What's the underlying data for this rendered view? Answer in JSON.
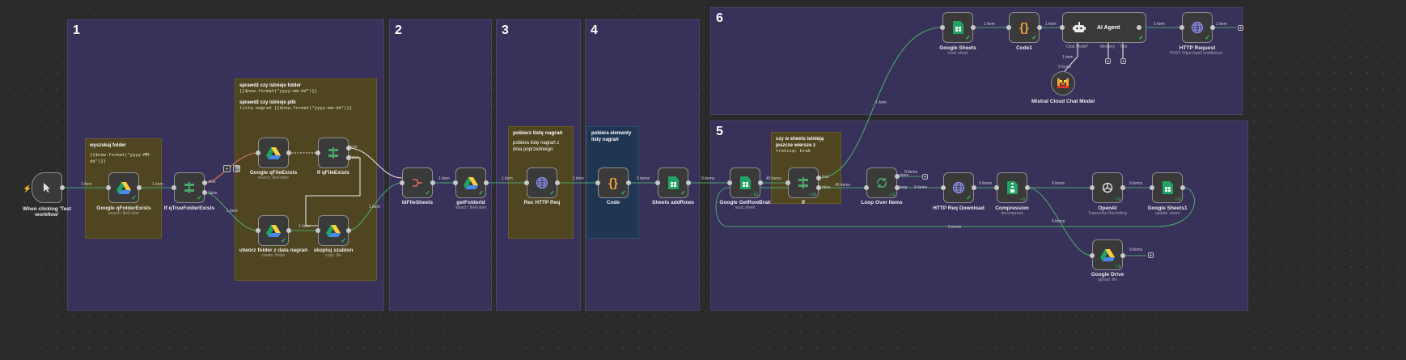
{
  "areas": {
    "a1": "1",
    "a2": "2",
    "a3": "3",
    "a4": "4",
    "a5": "5",
    "a6": "6"
  },
  "stickies": {
    "s1": {
      "title": "wyszukaj folder",
      "code": "{{$now.format(\"yyyy-MM-dd\")}}"
    },
    "s2": {
      "title1": "sprawdź czy istnieje folder",
      "code1": "{{$now.format(\"yyyy-mm-dd\")}}",
      "title2": "sprawdź czy istnieje plik",
      "code2": "lista nagrań {{$now.format(\"yyyy-mm-dd\")}}"
    },
    "s3": {
      "title": "pobierz listę nagrań",
      "body": "pobiera listę nagrań z dnia poprzedniego"
    },
    "s4": {
      "title": "pobiera elementy listy nagrań"
    },
    "s5": {
      "title": "czy w sheets istnieją jeszcze wiersze z",
      "code": "treścią: brak"
    }
  },
  "nodes": {
    "trigger": {
      "label": "When clicking 'Test workflow'",
      "icon": "cursor-icon"
    },
    "gfolder": {
      "label": "Google qFolderExists",
      "sub": "search: fileFolder",
      "icon": "google-drive-icon"
    },
    "if1": {
      "label": "If qTrueFolderExists",
      "icon": "if-icon"
    },
    "gfile": {
      "label": "Google qFileExists",
      "sub": "search: fileFolder",
      "icon": "google-drive-icon"
    },
    "if2": {
      "label": "If qFileExists",
      "icon": "if-icon"
    },
    "create": {
      "label": "utwórz folder z data nagrań",
      "sub": "create: folder",
      "icon": "google-drive-icon"
    },
    "copy": {
      "label": "skopiuj szablon",
      "sub": "copy: file",
      "icon": "google-drive-icon"
    },
    "idfile": {
      "label": "IdFileSheets",
      "icon": "merge-icon"
    },
    "getfolder": {
      "label": "getFolderId",
      "sub": "search: fileFolder",
      "icon": "google-drive-icon"
    },
    "rec": {
      "label": "Rec HTTP Req",
      "icon": "globe-icon"
    },
    "code": {
      "label": "Code",
      "icon": "code-icon"
    },
    "addrows": {
      "label": "Sheets addRows",
      "icon": "google-sheets-icon"
    },
    "getrow": {
      "label": "Google GetRowBrak",
      "sub": "read: sheet",
      "icon": "google-sheets-icon",
      "count": "10"
    },
    "if3": {
      "label": "If",
      "icon": "if-icon",
      "count": "10"
    },
    "loop": {
      "label": "Loop Over Items",
      "icon": "loop-icon",
      "count": "2"
    },
    "httpdl": {
      "label": "HTTP Req Download",
      "icon": "globe-icon"
    },
    "comp": {
      "label": "Compression",
      "sub": "decompress",
      "icon": "compression-icon",
      "count": "9"
    },
    "openai": {
      "label": "OpenAI",
      "sub": "Transcribe Recording",
      "icon": "openai-icon",
      "count": "9"
    },
    "sheets1": {
      "label": "Google Sheets1",
      "sub": "update: sheet",
      "icon": "google-sheets-icon",
      "count": "9"
    },
    "gdrive": {
      "label": "Google Drive",
      "sub": "upload: file",
      "icon": "google-drive-icon",
      "count": "9"
    },
    "gsheets": {
      "label": "Google Sheets",
      "sub": "read: sheet",
      "icon": "google-sheets-icon"
    },
    "code1": {
      "label": "Code1",
      "icon": "code-icon"
    },
    "agent": {
      "label": "AI Agent",
      "icon": "robot-icon"
    },
    "httpreq": {
      "label": "HTTP Request",
      "sub": "POST: https://api2.multibrit.pl...",
      "icon": "globe-icon"
    },
    "mistral": {
      "label": "Mistral Cloud Chat Model",
      "icon": "mistral-icon"
    }
  },
  "agent_ports": {
    "chat": "Chat Model*",
    "memory": "Memory",
    "tool": "Tool"
  },
  "edges": {
    "e1": "1 item",
    "e2": "1 item",
    "true": "true",
    "false": "false",
    "e3": "1 item",
    "e4": "1 item",
    "e5": "1 item",
    "e6": "1 item",
    "e7": "1 item",
    "e8": "1 item",
    "e9": "9 items",
    "e10": "9 items",
    "e11": "45 items",
    "e12": "1 item",
    "e13": "45 items",
    "done": "done",
    "loop": "loop",
    "e14": "9 items",
    "e15": "9 items",
    "e16": "9 items",
    "e17": "9 items",
    "e18": "9 items",
    "e19": "9 items",
    "e20": "9 items",
    "e21": "9 items",
    "e22": "1 item",
    "e23": "1 item",
    "e24": "1 item",
    "e25": "1 item",
    "e26": "1 item",
    "e27": "9 items",
    "e28": "9 items"
  },
  "colors": {
    "area": "#38315a",
    "sticky": "#4f4520",
    "edge": "#4aa56c",
    "ok": "#39c46a"
  }
}
